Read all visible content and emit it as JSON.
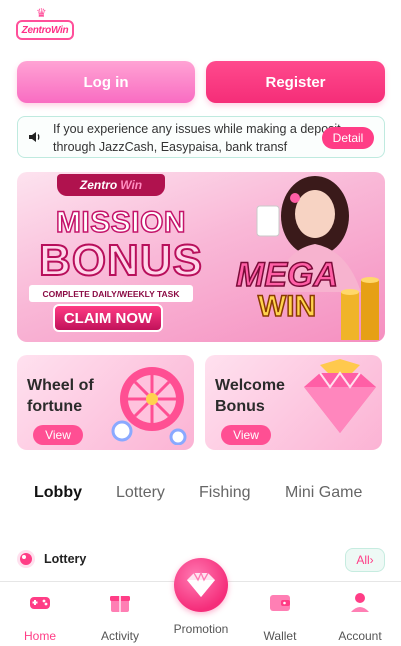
{
  "logo": {
    "text": "ZentroWin"
  },
  "auth": {
    "login_label": "Log in",
    "register_label": "Register"
  },
  "notice": {
    "text": "If you experience any issues while making a deposit through JazzCash, Easypaisa, bank transf",
    "detail_label": "Detail",
    "icon": "speaker-icon"
  },
  "banner": {
    "brand": "Zentro",
    "brand_highlight": "Win",
    "headline_1": "MISSION",
    "headline_2": "BONUS",
    "subline": "COMPLETE DAILY/WEEKLY TASK",
    "cta": "CLAIM NOW",
    "promo_1": "MEGA",
    "promo_2": "WIN"
  },
  "cards": [
    {
      "title": "Wheel of fortune",
      "button": "View"
    },
    {
      "title": "Welcome Bonus",
      "button": "View"
    }
  ],
  "tabs": [
    {
      "label": "Lobby",
      "active": true
    },
    {
      "label": "Lottery"
    },
    {
      "label": "Fishing"
    },
    {
      "label": "Mini Game"
    }
  ],
  "section": {
    "title": "Lottery",
    "all_label": "All›"
  },
  "nav": [
    {
      "label": "Home",
      "icon": "gamepad-icon",
      "active": true
    },
    {
      "label": "Activity",
      "icon": "gift-icon"
    },
    {
      "label": "Promotion",
      "icon": "diamond-icon"
    },
    {
      "label": "Wallet",
      "icon": "wallet-icon"
    },
    {
      "label": "Account",
      "icon": "user-icon"
    }
  ],
  "colors": {
    "accent": "#ff3d86",
    "accent_light": "#fba3d4"
  }
}
